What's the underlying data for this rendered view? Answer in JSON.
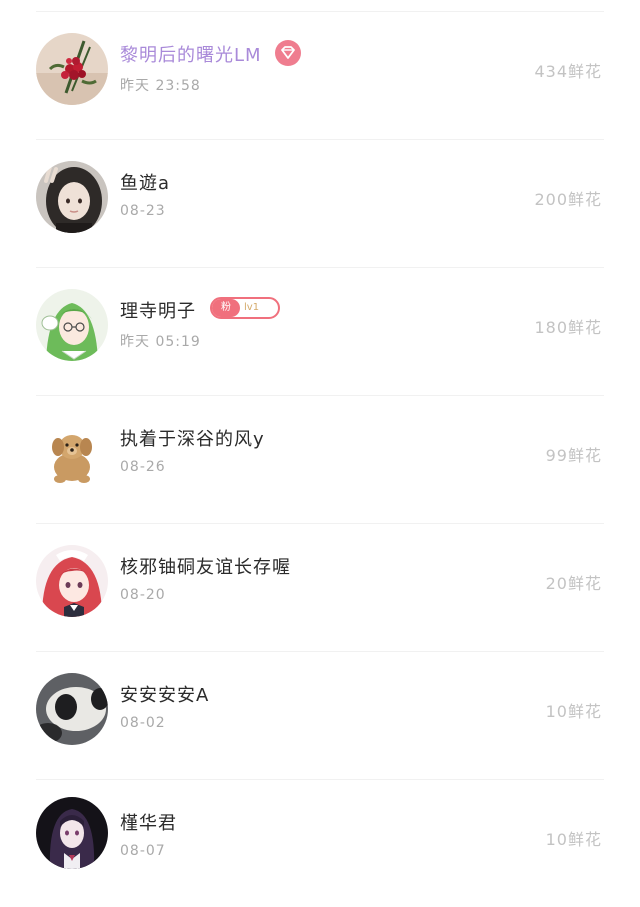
{
  "rows": [
    {
      "name": "黎明后的曙光LM",
      "time": "昨天 23:58",
      "flowers": "434鲜花",
      "avatar": "red-flower-bouquet",
      "badge": "diamond"
    },
    {
      "name": "鱼遊a",
      "time": "08-23",
      "flowers": "200鲜花",
      "avatar": "girl-selfie-peace-sign"
    },
    {
      "name": "理寺明子",
      "time": "昨天 05:19",
      "flowers": "180鲜花",
      "avatar": "green-hair-anime-girl",
      "badge": "fan"
    },
    {
      "name": "执着于深谷的风y",
      "time": "08-26",
      "flowers": "99鲜花",
      "avatar": "plush-dog-toy"
    },
    {
      "name": "核邪铀硐友谊长存喔",
      "time": "08-20",
      "flowers": "20鲜花",
      "avatar": "red-hair-anime-girl"
    },
    {
      "name": "安安安安A",
      "time": "08-02",
      "flowers": "10鲜花",
      "avatar": "panda-closeup"
    },
    {
      "name": "槿华君",
      "time": "08-07",
      "flowers": "10鲜花",
      "avatar": "dark-hair-anime-girl"
    }
  ],
  "fan_badge": {
    "left_label": "粉",
    "right_label": "lv1"
  },
  "colors": {
    "vip_name": "#a98ad9",
    "diamond": "#ef7d8f",
    "fan_badge": "#f0707d",
    "secondary_text": "#a9a9a9",
    "flowers_text": "#c3c3c3"
  }
}
